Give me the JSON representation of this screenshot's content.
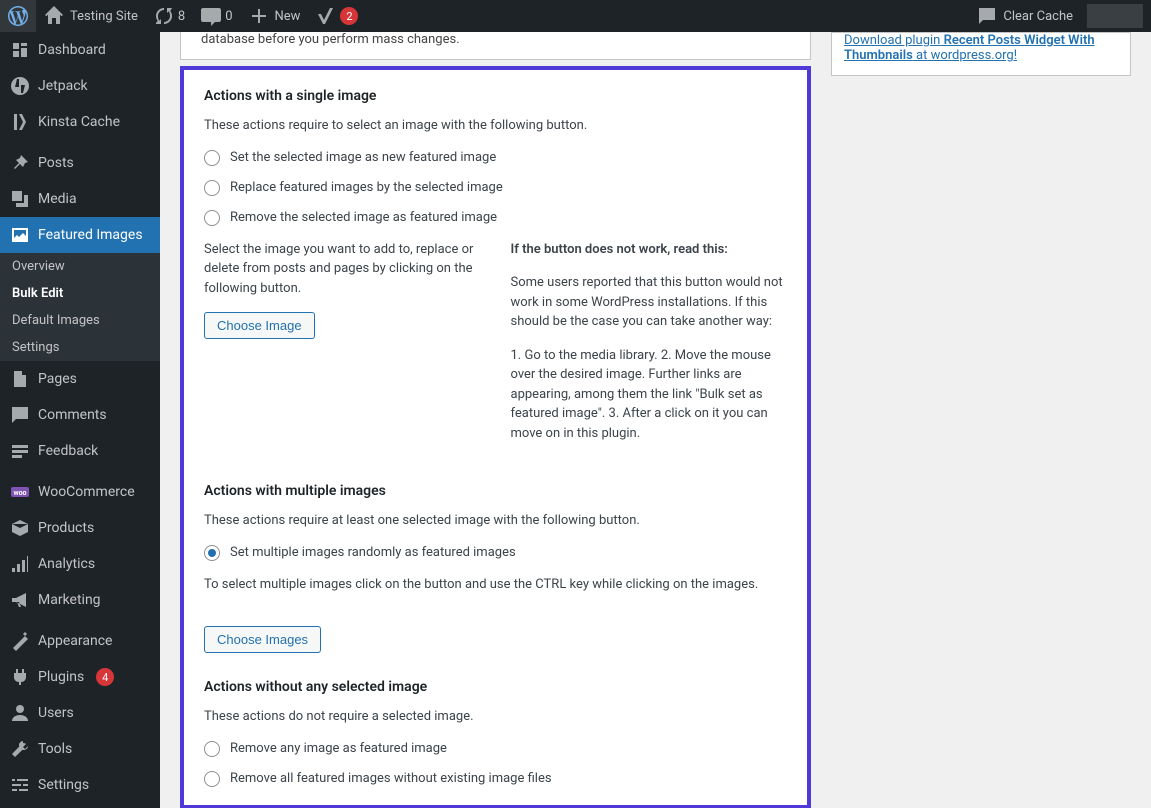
{
  "adminbar": {
    "site_name": "Testing Site",
    "updates_count": "8",
    "comments_count": "0",
    "new_label": "New",
    "yoast_count": "2",
    "clear_cache": "Clear Cache"
  },
  "sidebar": {
    "dashboard": "Dashboard",
    "jetpack": "Jetpack",
    "kinsta": "Kinsta Cache",
    "posts": "Posts",
    "media": "Media",
    "featured_images": "Featured Images",
    "fi_sub": {
      "overview": "Overview",
      "bulk_edit": "Bulk Edit",
      "default_images": "Default Images",
      "settings": "Settings"
    },
    "pages": "Pages",
    "comments": "Comments",
    "feedback": "Feedback",
    "woocommerce": "WooCommerce",
    "products": "Products",
    "analytics": "Analytics",
    "marketing": "Marketing",
    "appearance": "Appearance",
    "plugins": "Plugins",
    "plugins_count": "4",
    "users": "Users",
    "tools": "Tools",
    "settings": "Settings"
  },
  "intro_tail": "database before you perform mass changes.",
  "s1": {
    "heading": "Actions with a single image",
    "desc": "These actions require to select an image with the following button.",
    "r1": "Set the selected image as new featured image",
    "r2": "Replace featured images by the selected image",
    "r3": "Remove the selected image as featured image",
    "left_p": "Select the image you want to add to, replace or delete from posts and pages by clicking on the following button.",
    "btn": "Choose Image",
    "right_h": "If the button does not work, read this:",
    "right_p1": "Some users reported that this button would not work in some WordPress installations. If this should be the case you can take another way:",
    "right_p2": "1. Go to the media library. 2. Move the mouse over the desired image. Further links are appearing, among them the link \"Bulk set as featured image\". 3. After a click on it you can move on in this plugin."
  },
  "s2": {
    "heading": "Actions with multiple images",
    "desc": "These actions require at least one selected image with the following button.",
    "r1": "Set multiple images randomly as featured images",
    "hint": "To select multiple images click on the button and use the CTRL key while clicking on the images.",
    "btn": "Choose Images"
  },
  "s3": {
    "heading": "Actions without any selected image",
    "desc": "These actions do not require a selected image.",
    "r1": "Remove any image as featured image",
    "r2": "Remove all featured images without existing image files"
  },
  "sidebox": {
    "link_pre": "Download plugin",
    "link_strong": "Recent Posts Widget With Thumbnails",
    "link_post": "at wordpress.org!"
  }
}
